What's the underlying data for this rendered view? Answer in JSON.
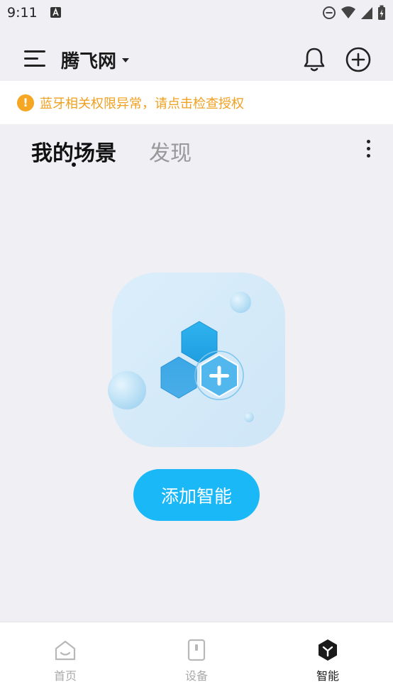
{
  "status_bar": {
    "time": "9:11"
  },
  "app_bar": {
    "title": "腾飞网"
  },
  "alert": {
    "text": "蓝牙相关权限异常，请点击检查授权"
  },
  "tabs": [
    {
      "label": "我的场景",
      "active": true
    },
    {
      "label": "发现",
      "active": false
    }
  ],
  "empty_state": {
    "button_label": "添加智能"
  },
  "bottom_nav": [
    {
      "label": "首页",
      "icon": "home-icon",
      "active": false
    },
    {
      "label": "设备",
      "icon": "device-icon",
      "active": false
    },
    {
      "label": "智能",
      "icon": "smart-icon",
      "active": true
    }
  ],
  "colors": {
    "accent": "#1ab8f7",
    "warning": "#f5a623",
    "background": "#efeff4"
  }
}
